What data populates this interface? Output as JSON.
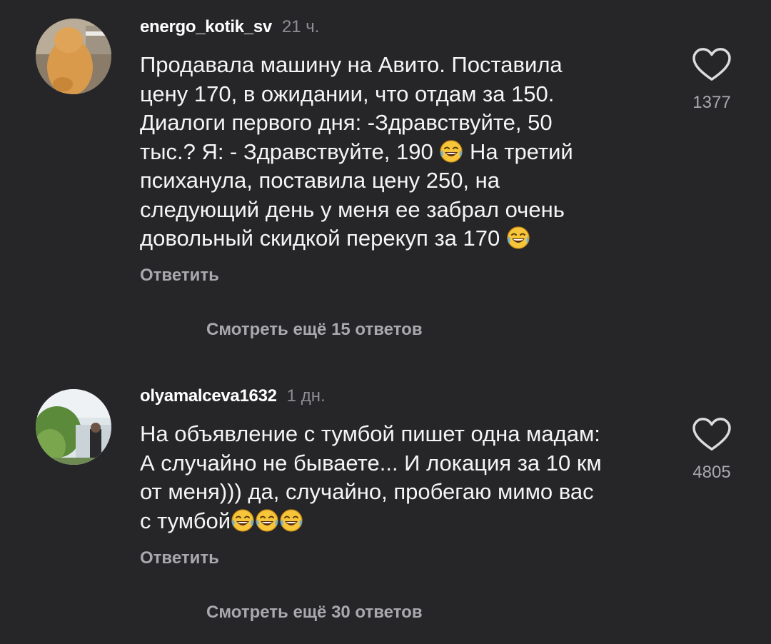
{
  "comments": [
    {
      "username": "energo_kotik_sv",
      "time": "21 ч.",
      "text_lines": [
        "Продавала машину на Авито. Поставила",
        "цену 170, в ожидании, что отдам за 150.",
        "Диалоги первого дня: -Здравствуйте, 50",
        "тыс.? Я: - Здравствуйте, 190",
        "На третий",
        "психанула, поставила цену 250, на",
        "следующий день у меня ее забрал очень",
        "довольный скидкой перекуп за 170"
      ],
      "likes": "1377",
      "reply_label": "Ответить",
      "more_replies_label": "Смотреть ещё 15 ответов",
      "emoji": "face-with-tears-of-joy"
    },
    {
      "username": "olyamalceva1632",
      "time": "1 дн.",
      "text_lines": [
        "На объявление с тумбой пишет одна мадам:",
        "А случайно не бываете... И локация за 10 км",
        "от меня))) да, случайно, пробегаю мимо вас",
        "с тумбой"
      ],
      "likes": "4805",
      "reply_label": "Ответить",
      "more_replies_label": "Смотреть ещё 30 ответов",
      "emoji": "face-with-tears-of-joy"
    }
  ],
  "colors": {
    "background": "#262629",
    "text": "#f5f5f5",
    "secondary": "#a8a8ad",
    "time": "#8e8e93",
    "emoji": "#f7c53a"
  },
  "icons": {
    "like": "heart-outline-icon",
    "emoji": "face-with-tears-of-joy-icon"
  }
}
